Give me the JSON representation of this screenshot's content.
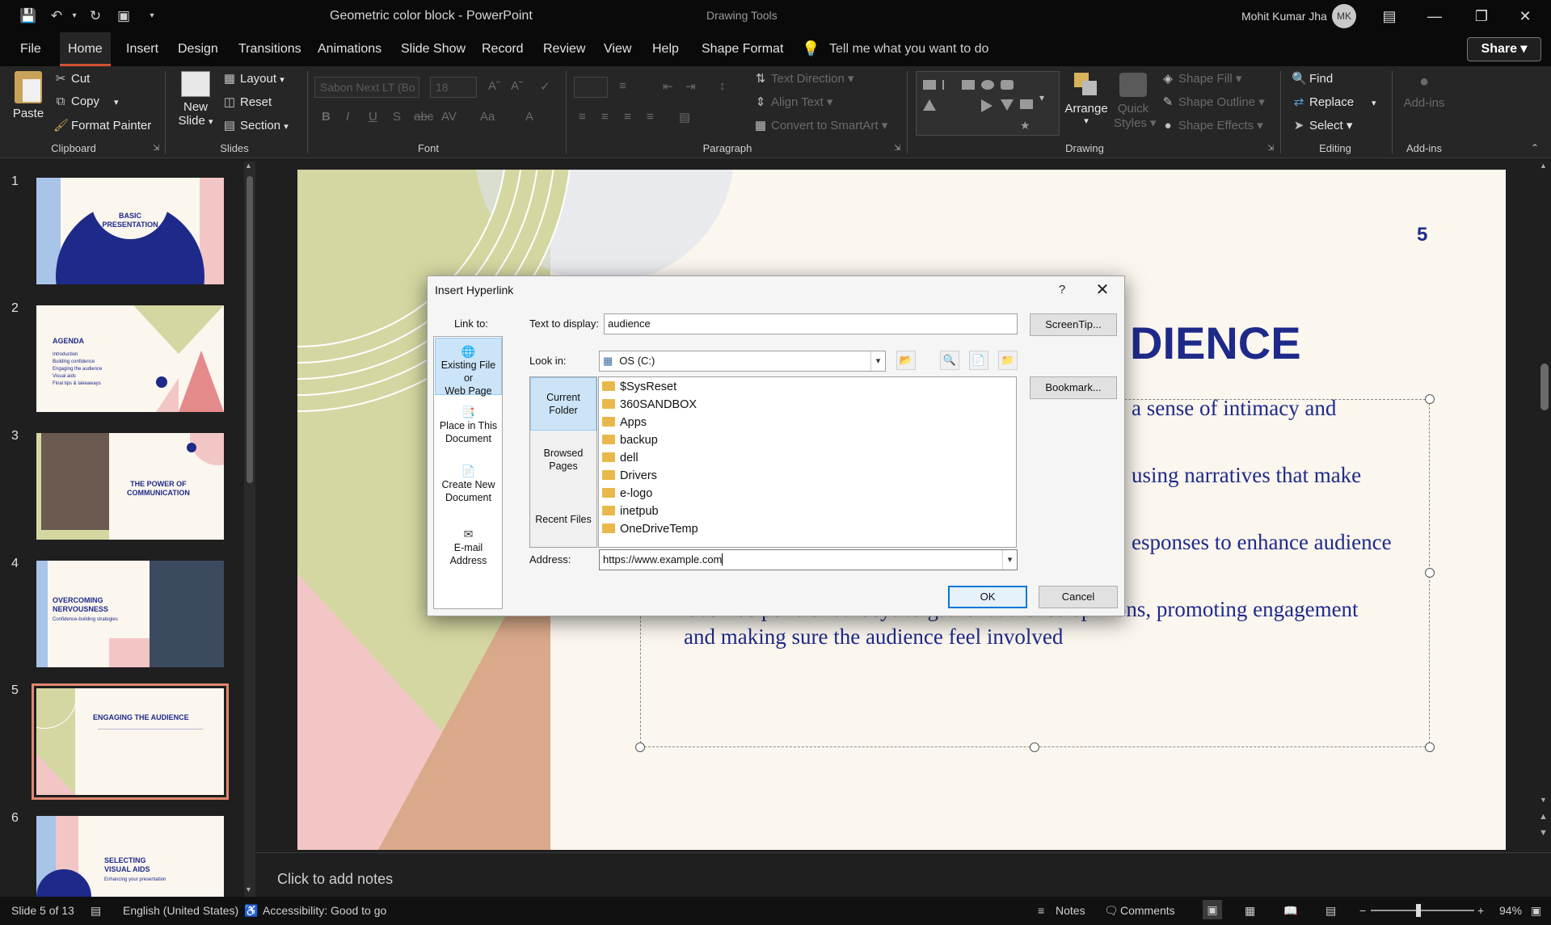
{
  "titlebar": {
    "doc_title": "Geometric color block  -  PowerPoint",
    "context_title": "Drawing Tools",
    "user_name": "Mohit Kumar Jha",
    "user_initials": "MK"
  },
  "menu": {
    "tabs": [
      "File",
      "Home",
      "Insert",
      "Design",
      "Transitions",
      "Animations",
      "Slide Show",
      "Record",
      "Review",
      "View",
      "Help",
      "Shape Format"
    ],
    "active_tab": "Home",
    "tell_me": "Tell me what you want to do",
    "share": "Share"
  },
  "ribbon": {
    "clipboard": {
      "paste": "Paste",
      "cut": "Cut",
      "copy": "Copy",
      "format_painter": "Format Painter",
      "label": "Clipboard"
    },
    "slides": {
      "new_slide_1": "New",
      "new_slide_2": "Slide",
      "layout": "Layout",
      "reset": "Reset",
      "section": "Section",
      "label": "Slides"
    },
    "font": {
      "font_name": "Sabon Next LT (Bo",
      "font_size": "18",
      "label": "Font"
    },
    "paragraph": {
      "text_direction": "Text Direction",
      "align_text": "Align Text",
      "convert_smartart": "Convert to SmartArt",
      "label": "Paragraph"
    },
    "drawing": {
      "arrange": "Arrange",
      "quick_styles_1": "Quick",
      "quick_styles_2": "Styles",
      "shape_fill": "Shape Fill",
      "shape_outline": "Shape Outline",
      "shape_effects": "Shape Effects",
      "label": "Drawing"
    },
    "editing": {
      "find": "Find",
      "replace": "Replace",
      "select": "Select",
      "label": "Editing"
    },
    "addins": {
      "addins": "Add-ins",
      "label": "Add-ins"
    }
  },
  "thumbnails": [
    {
      "num": "1",
      "title": "BASIC\nPRESENTATION"
    },
    {
      "num": "2",
      "title": "AGENDA",
      "items": [
        "Introduction",
        "Building confidence",
        "Engaging the audience",
        "Visual aids",
        "Final tips & takeaways"
      ]
    },
    {
      "num": "3",
      "title": "THE POWER OF\nCOMMUNICATION"
    },
    {
      "num": "4",
      "title": "OVERCOMING\nNERVOUSNESS",
      "sub": "Confidence-building strategies"
    },
    {
      "num": "5",
      "title": "ENGAGING THE AUDIENCE"
    },
    {
      "num": "6",
      "title": "SELECTING\nVISUAL AIDS",
      "sub": "Enhancing your presentation"
    }
  ],
  "slide": {
    "number": "5",
    "title_visible": "DIENCE",
    "bullets": [
      "a sense of intimacy and",
      "using narratives that make",
      "esponses to enhance audience",
      "Use live polls or surveys to gather audience opinions, promoting engagement",
      "and making sure the audience feel involved"
    ]
  },
  "notes": {
    "placeholder": "Click to add notes"
  },
  "status": {
    "slide_of": "Slide 5 of 13",
    "language": "English (United States)",
    "accessibility": "Accessibility: Good to go",
    "notes": "Notes",
    "comments": "Comments",
    "zoom": "94%"
  },
  "dialog": {
    "title": "Insert Hyperlink",
    "help": "?",
    "link_to_label": "Link to:",
    "link_to": [
      {
        "l1": "Existing File or",
        "l2": "Web Page"
      },
      {
        "l1": "Place in This",
        "l2": "Document"
      },
      {
        "l1": "Create New",
        "l2": "Document"
      },
      {
        "l1": "E-mail Address",
        "l2": ""
      }
    ],
    "text_to_display_label": "Text to display:",
    "text_to_display": "audience",
    "screentip": "ScreenTip...",
    "look_in_label": "Look in:",
    "look_in": "OS (C:)",
    "bookmark": "Bookmark...",
    "side_tabs": [
      {
        "l1": "Current",
        "l2": "Folder"
      },
      {
        "l1": "Browsed",
        "l2": "Pages"
      },
      {
        "l1": "Recent Files",
        "l2": ""
      }
    ],
    "folders": [
      "$SysReset",
      "360SANDBOX",
      "Apps",
      "backup",
      "dell",
      "Drivers",
      "e-logo",
      "inetpub",
      "OneDriveTemp"
    ],
    "address_label": "Address:",
    "address": "https://www.example.com",
    "ok": "OK",
    "cancel": "Cancel"
  }
}
